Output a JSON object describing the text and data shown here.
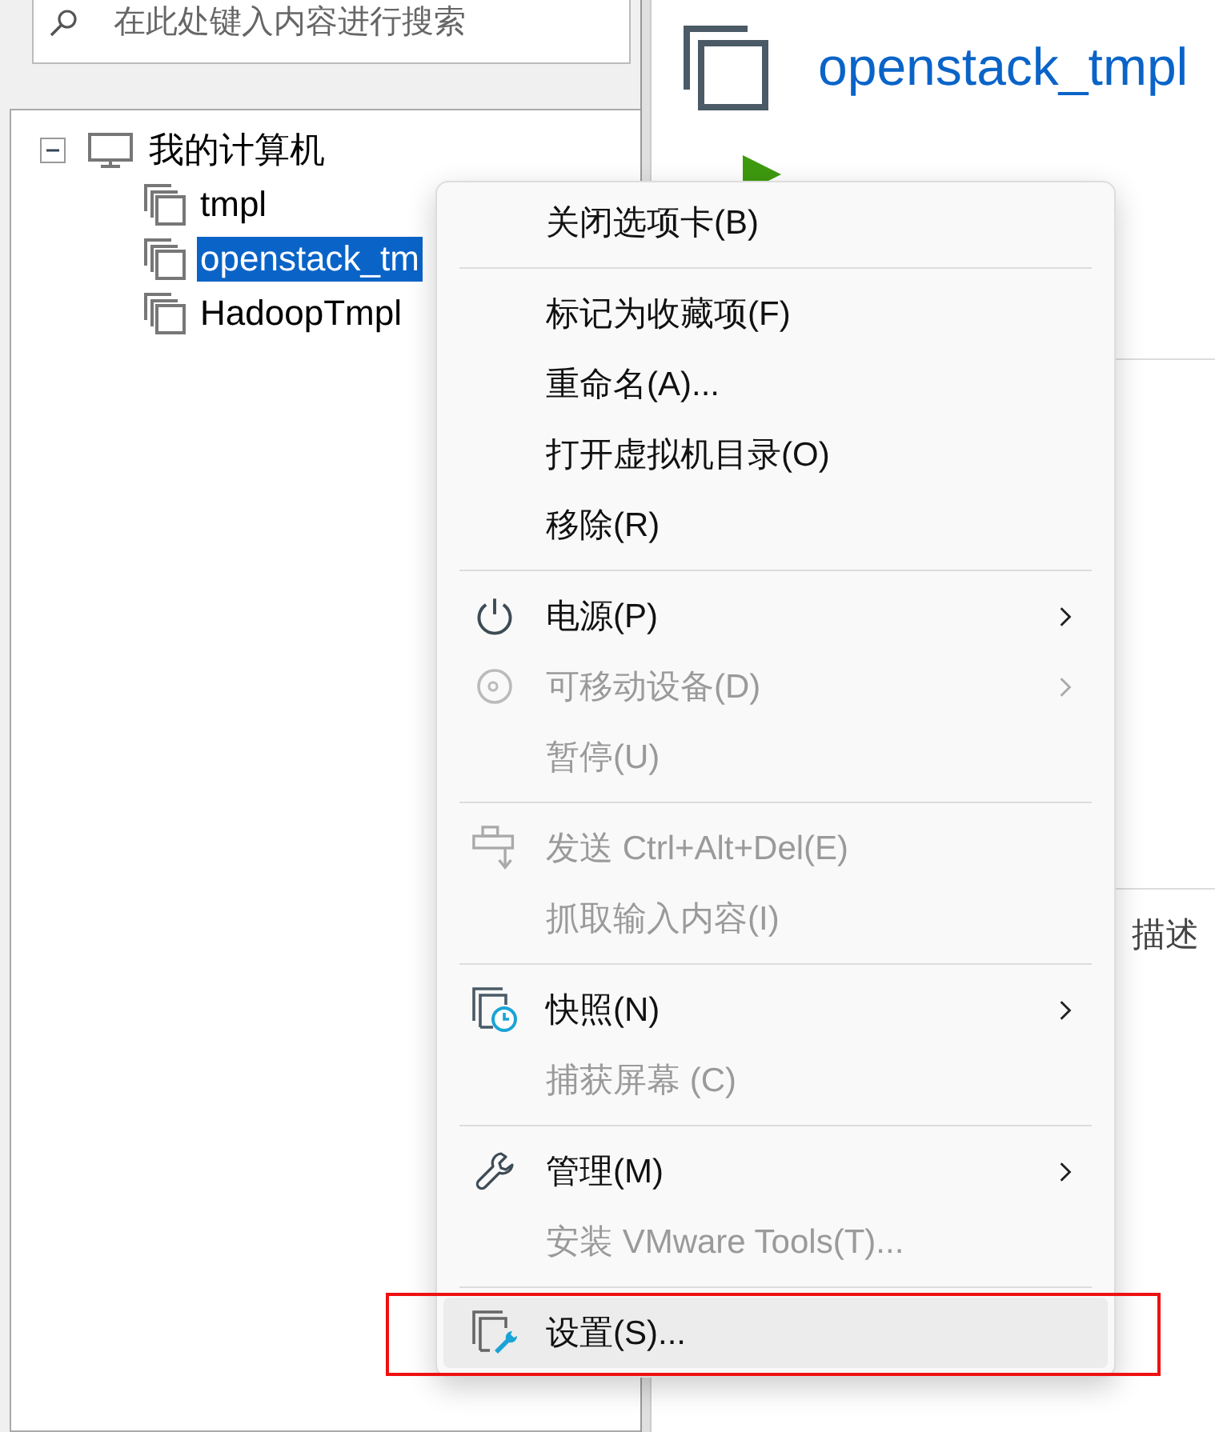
{
  "search": {
    "placeholder": "在此处键入内容进行搜索"
  },
  "tree": {
    "label": "我的计算机",
    "expanded": true,
    "children": [
      {
        "label": "tmpl",
        "selected": false
      },
      {
        "label": "openstack_tm",
        "selected": true
      },
      {
        "label": "HadoopTmpl",
        "selected": false
      }
    ]
  },
  "details": {
    "title": "openstack_tmpl",
    "description_fragment": "描述"
  },
  "context_menu": {
    "groups": [
      [
        {
          "label": "关闭选项卡(B)",
          "kind": "plain",
          "disabled": false,
          "submenu": false,
          "highlighted": false,
          "marked": false
        }
      ],
      [
        {
          "label": "标记为收藏项(F)",
          "kind": "plain",
          "disabled": false,
          "submenu": false,
          "highlighted": false,
          "marked": false
        },
        {
          "label": "重命名(A)...",
          "kind": "plain",
          "disabled": false,
          "submenu": false,
          "highlighted": false,
          "marked": false
        },
        {
          "label": "打开虚拟机目录(O)",
          "kind": "plain",
          "disabled": false,
          "submenu": false,
          "highlighted": false,
          "marked": false
        },
        {
          "label": "移除(R)",
          "kind": "plain",
          "disabled": false,
          "submenu": false,
          "highlighted": false,
          "marked": false
        }
      ],
      [
        {
          "label": "电源(P)",
          "kind": "power",
          "disabled": false,
          "submenu": true,
          "highlighted": false,
          "marked": false
        },
        {
          "label": "可移动设备(D)",
          "kind": "disc",
          "disabled": true,
          "submenu": true,
          "highlighted": false,
          "marked": false
        },
        {
          "label": "暂停(U)",
          "kind": "plain",
          "disabled": true,
          "submenu": false,
          "highlighted": false,
          "marked": false
        }
      ],
      [
        {
          "label": "发送 Ctrl+Alt+Del(E)",
          "kind": "send",
          "disabled": true,
          "submenu": false,
          "highlighted": false,
          "marked": false
        },
        {
          "label": "抓取输入内容(I)",
          "kind": "plain",
          "disabled": true,
          "submenu": false,
          "highlighted": false,
          "marked": false
        }
      ],
      [
        {
          "label": "快照(N)",
          "kind": "snapshot",
          "disabled": false,
          "submenu": true,
          "highlighted": false,
          "marked": false
        },
        {
          "label": "捕获屏幕 (C)",
          "kind": "plain",
          "disabled": true,
          "submenu": false,
          "highlighted": false,
          "marked": false
        }
      ],
      [
        {
          "label": "管理(M)",
          "kind": "wrench",
          "disabled": false,
          "submenu": true,
          "highlighted": false,
          "marked": false
        },
        {
          "label": "安装 VMware Tools(T)...",
          "kind": "plain",
          "disabled": true,
          "submenu": false,
          "highlighted": false,
          "marked": false
        }
      ],
      [
        {
          "label": "设置(S)...",
          "kind": "settings",
          "disabled": false,
          "submenu": false,
          "highlighted": true,
          "marked": true
        }
      ]
    ]
  }
}
